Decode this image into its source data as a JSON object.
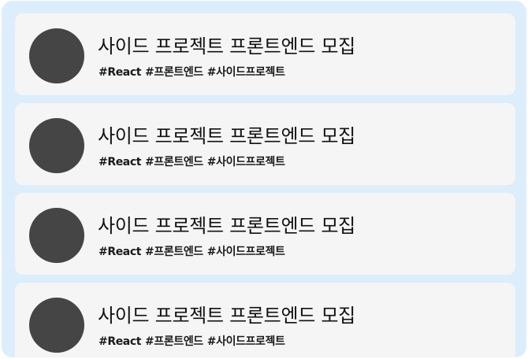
{
  "posts": [
    {
      "title": "사이드 프로젝트 프론트엔드 모집",
      "tags": [
        "#React",
        "#프론트엔드",
        "#사이드프로젝트"
      ]
    },
    {
      "title": "사이드 프로젝트 프론트엔드 모집",
      "tags": [
        "#React",
        "#프론트엔드",
        "#사이드프로젝트"
      ]
    },
    {
      "title": "사이드 프로젝트 프론트엔드 모집",
      "tags": [
        "#React",
        "#프론트엔드",
        "#사이드프로젝트"
      ]
    },
    {
      "title": "사이드 프로젝트 프론트엔드 모집",
      "tags": [
        "#React",
        "#프론트엔드",
        "#사이드프로젝트"
      ]
    }
  ],
  "colors": {
    "panel_background": "#dcedfc",
    "card_background": "#f5f5f5",
    "avatar": "#454545"
  }
}
